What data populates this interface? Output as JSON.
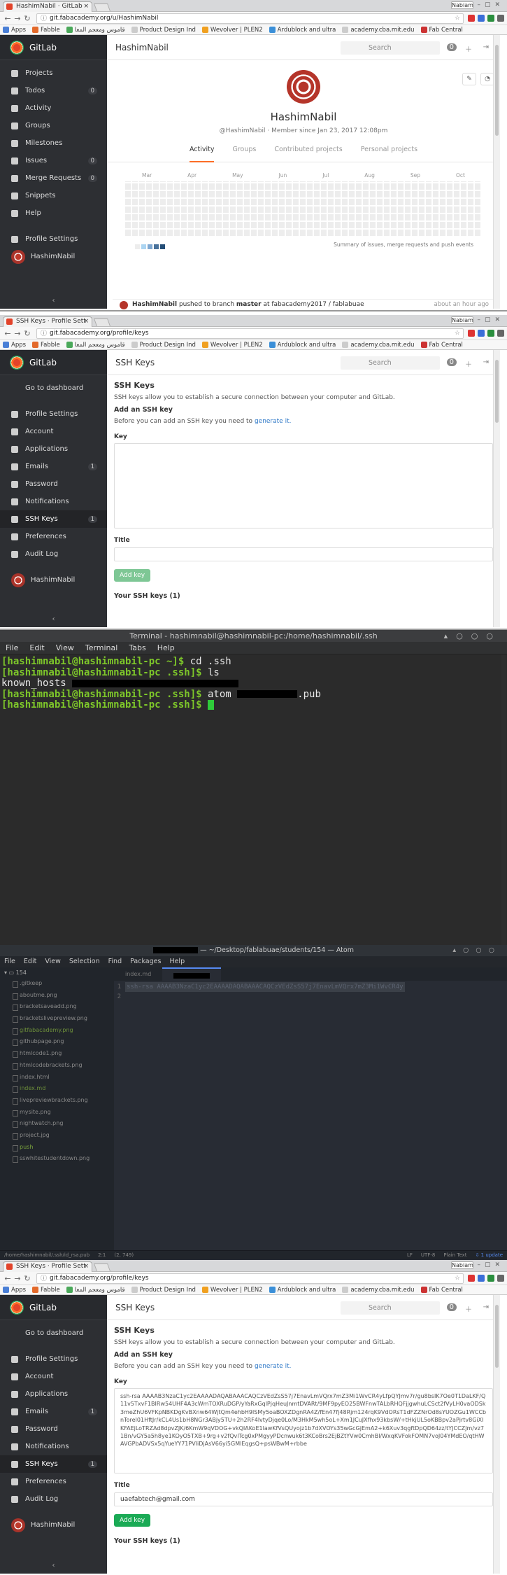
{
  "shared_bookmarks": [
    {
      "label": "Apps",
      "icon": "apps-grid-icon"
    },
    {
      "label": "Fabble",
      "icon": "fabble-icon"
    },
    {
      "label": "قاموس ومعجم المعا",
      "icon": "dictionary-icon"
    },
    {
      "label": "Product Design Ind",
      "icon": "doc-icon"
    },
    {
      "label": "Wevolver | PLEN2",
      "icon": "wevolver-icon"
    },
    {
      "label": "Ardublock and ultra",
      "icon": "page-icon"
    },
    {
      "label": "academy.cba.mit.edu",
      "icon": "doc-icon"
    },
    {
      "label": "Fab Central",
      "icon": "fab-icon"
    }
  ],
  "panel1": {
    "tab_title": "HashimNabil · GitLab",
    "url": "git.fabacademy.org/u/HashimNabil",
    "user_badge": "Nabiam",
    "logo_text": "GitLab",
    "header_title": "HashimNabil",
    "search_placeholder": "Search",
    "nav": [
      {
        "label": "Projects",
        "count": null,
        "icon": "house-icon"
      },
      {
        "label": "Todos",
        "count": "0",
        "icon": "bell-icon"
      },
      {
        "label": "Activity",
        "count": null,
        "icon": "dashboard-icon"
      },
      {
        "label": "Groups",
        "count": null,
        "icon": "group-icon"
      },
      {
        "label": "Milestones",
        "count": null,
        "icon": "clock-icon"
      },
      {
        "label": "Issues",
        "count": "0",
        "icon": "issue-icon"
      },
      {
        "label": "Merge Requests",
        "count": "0",
        "icon": "merge-icon"
      },
      {
        "label": "Snippets",
        "count": null,
        "icon": "clipboard-icon"
      },
      {
        "label": "Help",
        "count": null,
        "icon": "question-icon"
      },
      {
        "label": "Profile Settings",
        "count": null,
        "icon": "gear-icon"
      },
      {
        "label": "HashimNabil",
        "count": null,
        "icon": "avatar-icon"
      }
    ],
    "profile_name": "HashimNabil",
    "profile_handle": "@HashimNabil",
    "profile_since": "Member since Jan 23, 2017 12:08pm",
    "tabs": [
      "Activity",
      "Groups",
      "Contributed projects",
      "Personal projects"
    ],
    "months": [
      "Mar",
      "Apr",
      "May",
      "Jun",
      "Jul",
      "Aug",
      "Sep",
      "Oct"
    ],
    "summary": "Summary of issues, merge requests and push events",
    "event_user": "HashimNabil",
    "event_text": "pushed to branch",
    "event_branch": "master",
    "event_at": "at",
    "event_repo": "fabacademy2017 / fablabuae",
    "event_time": "about an hour ago"
  },
  "panel2": {
    "tab_title": "SSH Keys · Profile Sett",
    "url": "git.fabacademy.org/profile/keys",
    "user_badge": "Nabiam",
    "logo_text": "GitLab",
    "header_title": "SSH Keys",
    "search_placeholder": "Search",
    "nav": [
      {
        "label": "Go to dashboard",
        "count": null,
        "icon": "back-icon"
      },
      {
        "label": "Profile Settings",
        "count": null,
        "icon": "user-icon"
      },
      {
        "label": "Account",
        "count": null,
        "icon": "gear-icon"
      },
      {
        "label": "Applications",
        "count": null,
        "icon": "cloud-icon"
      },
      {
        "label": "Emails",
        "count": "1",
        "icon": "envelope-icon"
      },
      {
        "label": "Password",
        "count": null,
        "icon": "lock-icon"
      },
      {
        "label": "Notifications",
        "count": null,
        "icon": "bell-icon"
      },
      {
        "label": "SSH Keys",
        "count": "1",
        "icon": "key-icon"
      },
      {
        "label": "Preferences",
        "count": null,
        "icon": "image-icon"
      },
      {
        "label": "Audit Log",
        "count": null,
        "icon": "history-icon"
      },
      {
        "label": "HashimNabil",
        "count": null,
        "icon": "avatar-icon"
      }
    ],
    "page_title": "SSH Keys",
    "intro": "SSH keys allow you to establish a secure connection between your computer and GitLab.",
    "add_heading": "Add an SSH key",
    "before": "Before you can add an SSH key you need to",
    "generate_link": "generate it.",
    "key_label": "Key",
    "title_label": "Title",
    "add_button": "Add key",
    "your_keys": "Your SSH keys (1)"
  },
  "terminal": {
    "title": "Terminal - hashimnabil@hashimnabil-pc:/home/hashimnabil/.ssh",
    "menu": [
      "File",
      "Edit",
      "View",
      "Terminal",
      "Tabs",
      "Help"
    ],
    "line1_prompt": "[hashimnabil@hashimnabil-pc ~]$",
    "line1_cmd": " cd .ssh",
    "line2_prompt": "[hashimnabil@hashimnabil-pc .ssh]$",
    "line2_cmd": " ls",
    "line3_out": "known_hosts",
    "line4_prompt": "[hashimnabil@hashimnabil-pc .ssh]$",
    "line4_cmd": " atom ",
    "line4_suffix": ".pub",
    "line5_prompt": "[hashimnabil@hashimnabil-pc .ssh]$"
  },
  "atom": {
    "title": "— ~/Desktop/fablabuae/students/154 — Atom",
    "menu": [
      "File",
      "Edit",
      "View",
      "Selection",
      "Find",
      "Packages",
      "Help"
    ],
    "root_folder": "154",
    "files": [
      {
        "name": ".gitkeep",
        "kind": "normal"
      },
      {
        "name": "aboutme.png",
        "kind": "normal"
      },
      {
        "name": "bracketsaveadd.png",
        "kind": "normal"
      },
      {
        "name": "bracketslivepreview.png",
        "kind": "normal"
      },
      {
        "name": "gitfabacademy.png",
        "kind": "mod"
      },
      {
        "name": "githubpage.png",
        "kind": "normal"
      },
      {
        "name": "htmlcode1.png",
        "kind": "normal"
      },
      {
        "name": "htmlcodebrackets.png",
        "kind": "normal"
      },
      {
        "name": "index.html",
        "kind": "normal"
      },
      {
        "name": "index.md",
        "kind": "mod"
      },
      {
        "name": "livepreviewbrackets.png",
        "kind": "normal"
      },
      {
        "name": "mysite.png",
        "kind": "normal"
      },
      {
        "name": "nightwatch.png",
        "kind": "normal"
      },
      {
        "name": "project.jpg",
        "kind": "normal"
      },
      {
        "name": "push",
        "kind": "add"
      },
      {
        "name": "sswhitestudentdown.png",
        "kind": "normal"
      }
    ],
    "tab1": "index.md",
    "line1_num": "1",
    "line1": "ssh-rsa AAAAB3NzaC1yc2EAAAADAQABAAACAQCzVEdZsS57j7EnavLmVQrx7mZ3Mi1WvCR4y",
    "line2_num": "2",
    "status_path": "/home/hashimnabil/.ssh/id_rsa.pub",
    "status_pos": "2:1",
    "status_sel": "(2, 749)",
    "status_lf": "LF",
    "status_enc": "UTF-8",
    "status_grammar": "Plain Text",
    "status_update": "1 update"
  },
  "panel5": {
    "tab_title": "SSH Keys · Profile Sett",
    "url": "git.fabacademy.org/profile/keys",
    "user_badge": "Nabiam",
    "logo_text": "GitLab",
    "header_title": "SSH Keys",
    "search_placeholder": "Search",
    "page_title": "SSH Keys",
    "intro": "SSH keys allow you to establish a secure connection between your computer and GitLab.",
    "add_heading": "Add an SSH key",
    "before": "Before you can add an SSH key you need to",
    "generate_link": "generate it.",
    "key_label": "Key",
    "key_value": "ssh-rsa AAAAB3NzaC1yc2EAAAADAQABAAACAQCzVEdZsS57j7EnavLmVQrx7mZ3Mi1WvCR4yLfpQYJmv7r/gu8bsIK7Oe0T1DaLKF/Q11v5TxvF1BIRw54UHF4A3cWmTOXRuDGP/yYaRxGqlPjqHeuJnmtDVARt/9MF9pyEO25BWFnwTALbRHQFjjgwhuLCSct2fVyLH0vaODSk3meZhU6VFKpNBKDgKvBXnw64WjtQm4ehbH9lSMy5oaBOXZDgnRA4Z/fEn47fj48Rjm124rqK9VdORsT1dFZZNrOd8sYUOZGu1WCCbnToreI01HftJr/kCL4Us1bH8NGr3ABjy5TU+2h2RF4lvtyDjqe0Lo/M3HkM5wh5oL+Xm1JCuJXfhx93kbsW/+tHkjUL5oKBBpv2aPjrtv8GiXIKFAEjLoTRZAd8dpvZJK/6KmW9qVDOG+vkQIAKoE1lawKfVsQUyojz1b7dXVOYs35wGcGjEmA2+k6Xuv3qgftDpQD64zz/tYJCCZJm/vz71Bn/vGY5a5h8ye1KOyO5TXB+9rg+v2fQvlTcg0xPMgyyPDcnwuk6t3KCoBrs2EjBZtYVw0CmhBl/WxqKVFokFOMN7voJ04YMdEO/qtHWAVGPbADVSx5qYueYY71PVIiDjAsV66yi5GMlEqgsQ+psWBwM+rbbe",
    "title_label": "Title",
    "title_value": "uaefabtech@gmail.com",
    "add_button": "Add key",
    "your_keys": "Your SSH keys (1)"
  }
}
